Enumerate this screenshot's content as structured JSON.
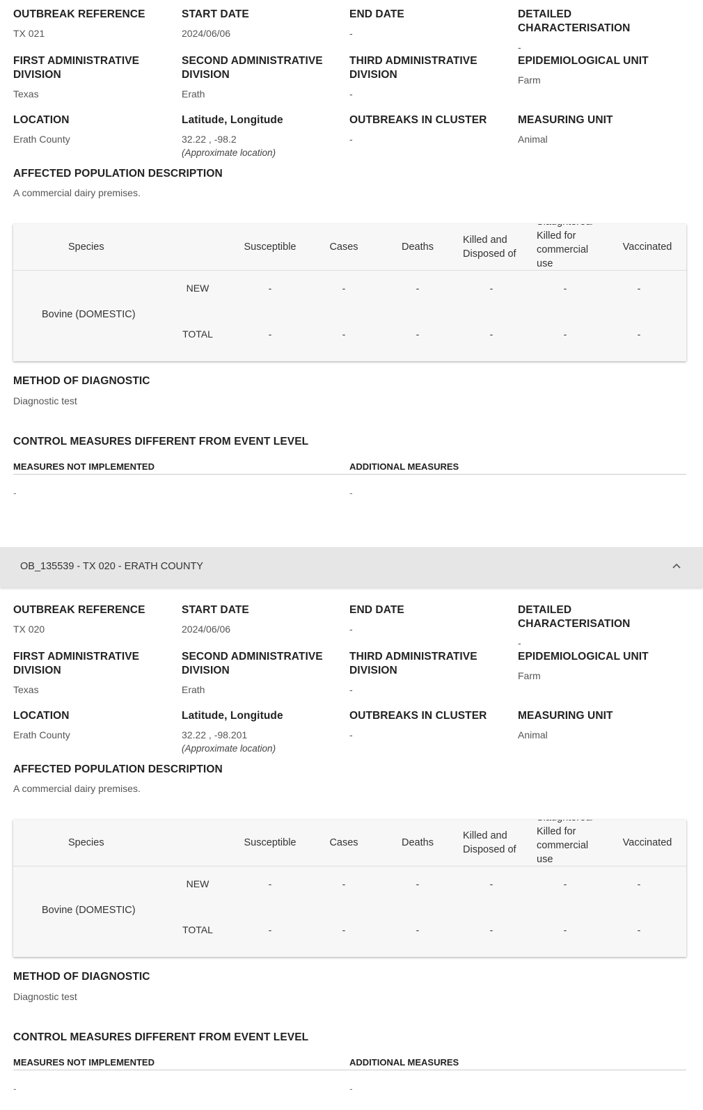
{
  "labels": {
    "outbreak_reference": "OUTBREAK REFERENCE",
    "start_date": "START DATE",
    "end_date": "END DATE",
    "detailed_characterisation": "DETAILED CHARACTERISATION",
    "first_admin_division": "FIRST ADMINISTRATIVE DIVISION",
    "second_admin_division": "SECOND ADMINISTRATIVE DIVISION",
    "third_admin_division": "THIRD ADMINISTRATIVE DIVISION",
    "epidemiological_unit": "EPIDEMIOLOGICAL UNIT",
    "location": "LOCATION",
    "lat_long": "Latitude, Longitude",
    "outbreaks_in_cluster": "OUTBREAKS IN CLUSTER",
    "measuring_unit": "MEASURING UNIT",
    "affected_population": "AFFECTED POPULATION DESCRIPTION",
    "method_of_diagnostic": "METHOD OF DIAGNOSTIC",
    "control_measures": "CONTROL MEASURES DIFFERENT FROM EVENT LEVEL",
    "measures_not_implemented": "MEASURES NOT IMPLEMENTED",
    "additional_measures": "ADDITIONAL MEASURES",
    "approximate_location": "(Approximate location)"
  },
  "table_headers": {
    "species": "Species",
    "susceptible": "Susceptible",
    "cases": "Cases",
    "deaths": "Deaths",
    "killed": "Killed and Disposed of",
    "slaughtered": "Slaughtered/ Killed for commercial use",
    "vaccinated": "Vaccinated"
  },
  "row_labels": {
    "new": "NEW",
    "total": "TOTAL"
  },
  "accordion": {
    "title": "OB_135539 - TX 020 - ERATH COUNTY"
  },
  "outbreaks": [
    {
      "reference": "TX 021",
      "start_date": "2024/06/06",
      "end_date": "-",
      "detailed_characterisation": "-",
      "first_admin_division": "Texas",
      "second_admin_division": "Erath",
      "third_admin_division": "-",
      "epidemiological_unit": "Farm",
      "location": "Erath County",
      "lat_long": "32.22 , -98.2",
      "outbreaks_in_cluster": "-",
      "measuring_unit": "Animal",
      "affected_population": "A commercial dairy premises.",
      "species": "Bovine (DOMESTIC)",
      "new": [
        "-",
        "-",
        "-",
        "-",
        "-",
        "-"
      ],
      "total": [
        "-",
        "-",
        "-",
        "-",
        "-",
        "-"
      ],
      "method_of_diagnostic": "Diagnostic test",
      "measures_not_implemented": "-",
      "additional_measures": "-"
    },
    {
      "reference": "TX 020",
      "start_date": "2024/06/06",
      "end_date": "-",
      "detailed_characterisation": "-",
      "first_admin_division": "Texas",
      "second_admin_division": "Erath",
      "third_admin_division": "-",
      "epidemiological_unit": "Farm",
      "location": "Erath County",
      "lat_long": "32.22 , -98.201",
      "outbreaks_in_cluster": "-",
      "measuring_unit": "Animal",
      "affected_population": "A commercial dairy premises.",
      "species": "Bovine (DOMESTIC)",
      "new": [
        "-",
        "-",
        "-",
        "-",
        "-",
        "-"
      ],
      "total": [
        "-",
        "-",
        "-",
        "-",
        "-",
        "-"
      ],
      "method_of_diagnostic": "Diagnostic test",
      "measures_not_implemented": "-",
      "additional_measures": "-"
    }
  ]
}
